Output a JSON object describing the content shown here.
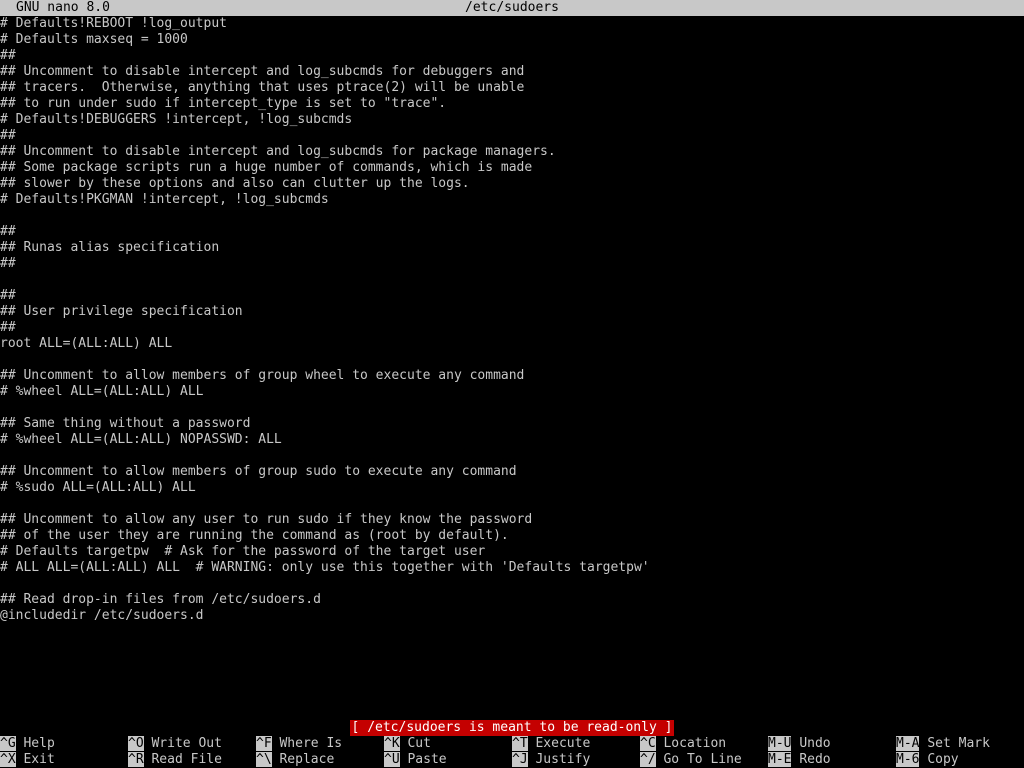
{
  "titlebar": {
    "version": "GNU nano 8.0",
    "filename": "/etc/sudoers"
  },
  "editor": {
    "lines": [
      "# Defaults!REBOOT !log_output",
      "# Defaults maxseq = 1000",
      "##",
      "## Uncomment to disable intercept and log_subcmds for debuggers and",
      "## tracers.  Otherwise, anything that uses ptrace(2) will be unable",
      "## to run under sudo if intercept_type is set to \"trace\".",
      "# Defaults!DEBUGGERS !intercept, !log_subcmds",
      "##",
      "## Uncomment to disable intercept and log_subcmds for package managers.",
      "## Some package scripts run a huge number of commands, which is made",
      "## slower by these options and also can clutter up the logs.",
      "# Defaults!PKGMAN !intercept, !log_subcmds",
      "",
      "##",
      "## Runas alias specification",
      "##",
      "",
      "##",
      "## User privilege specification",
      "##",
      "root ALL=(ALL:ALL) ALL",
      "",
      "## Uncomment to allow members of group wheel to execute any command",
      "# %wheel ALL=(ALL:ALL) ALL",
      "",
      "## Same thing without a password",
      "# %wheel ALL=(ALL:ALL) NOPASSWD: ALL",
      "",
      "## Uncomment to allow members of group sudo to execute any command",
      "# %sudo ALL=(ALL:ALL) ALL",
      "",
      "## Uncomment to allow any user to run sudo if they know the password",
      "## of the user they are running the command as (root by default).",
      "# Defaults targetpw  # Ask for the password of the target user",
      "# ALL ALL=(ALL:ALL) ALL  # WARNING: only use this together with 'Defaults targetpw'",
      "",
      "## Read drop-in files from /etc/sudoers.d",
      "@includedir /etc/sudoers.d"
    ]
  },
  "status": {
    "message": "[ /etc/sudoers is meant to be read-only ]"
  },
  "shortcuts": {
    "row1": [
      {
        "key": "^G",
        "label": "Help"
      },
      {
        "key": "^O",
        "label": "Write Out"
      },
      {
        "key": "^F",
        "label": "Where Is"
      },
      {
        "key": "^K",
        "label": "Cut"
      },
      {
        "key": "^T",
        "label": "Execute"
      },
      {
        "key": "^C",
        "label": "Location"
      },
      {
        "key": "M-U",
        "label": "Undo"
      },
      {
        "key": "M-A",
        "label": "Set Mark"
      }
    ],
    "row2": [
      {
        "key": "^X",
        "label": "Exit"
      },
      {
        "key": "^R",
        "label": "Read File"
      },
      {
        "key": "^\\",
        "label": "Replace"
      },
      {
        "key": "^U",
        "label": "Paste"
      },
      {
        "key": "^J",
        "label": "Justify"
      },
      {
        "key": "^/",
        "label": "Go To Line"
      },
      {
        "key": "M-E",
        "label": "Redo"
      },
      {
        "key": "M-6",
        "label": "Copy"
      }
    ]
  },
  "colors": {
    "background": "#000000",
    "foreground": "#c8c8c8",
    "titlebar_bg": "#c8c8c8",
    "status_bg": "#c40000",
    "status_fg": "#ffffff"
  }
}
